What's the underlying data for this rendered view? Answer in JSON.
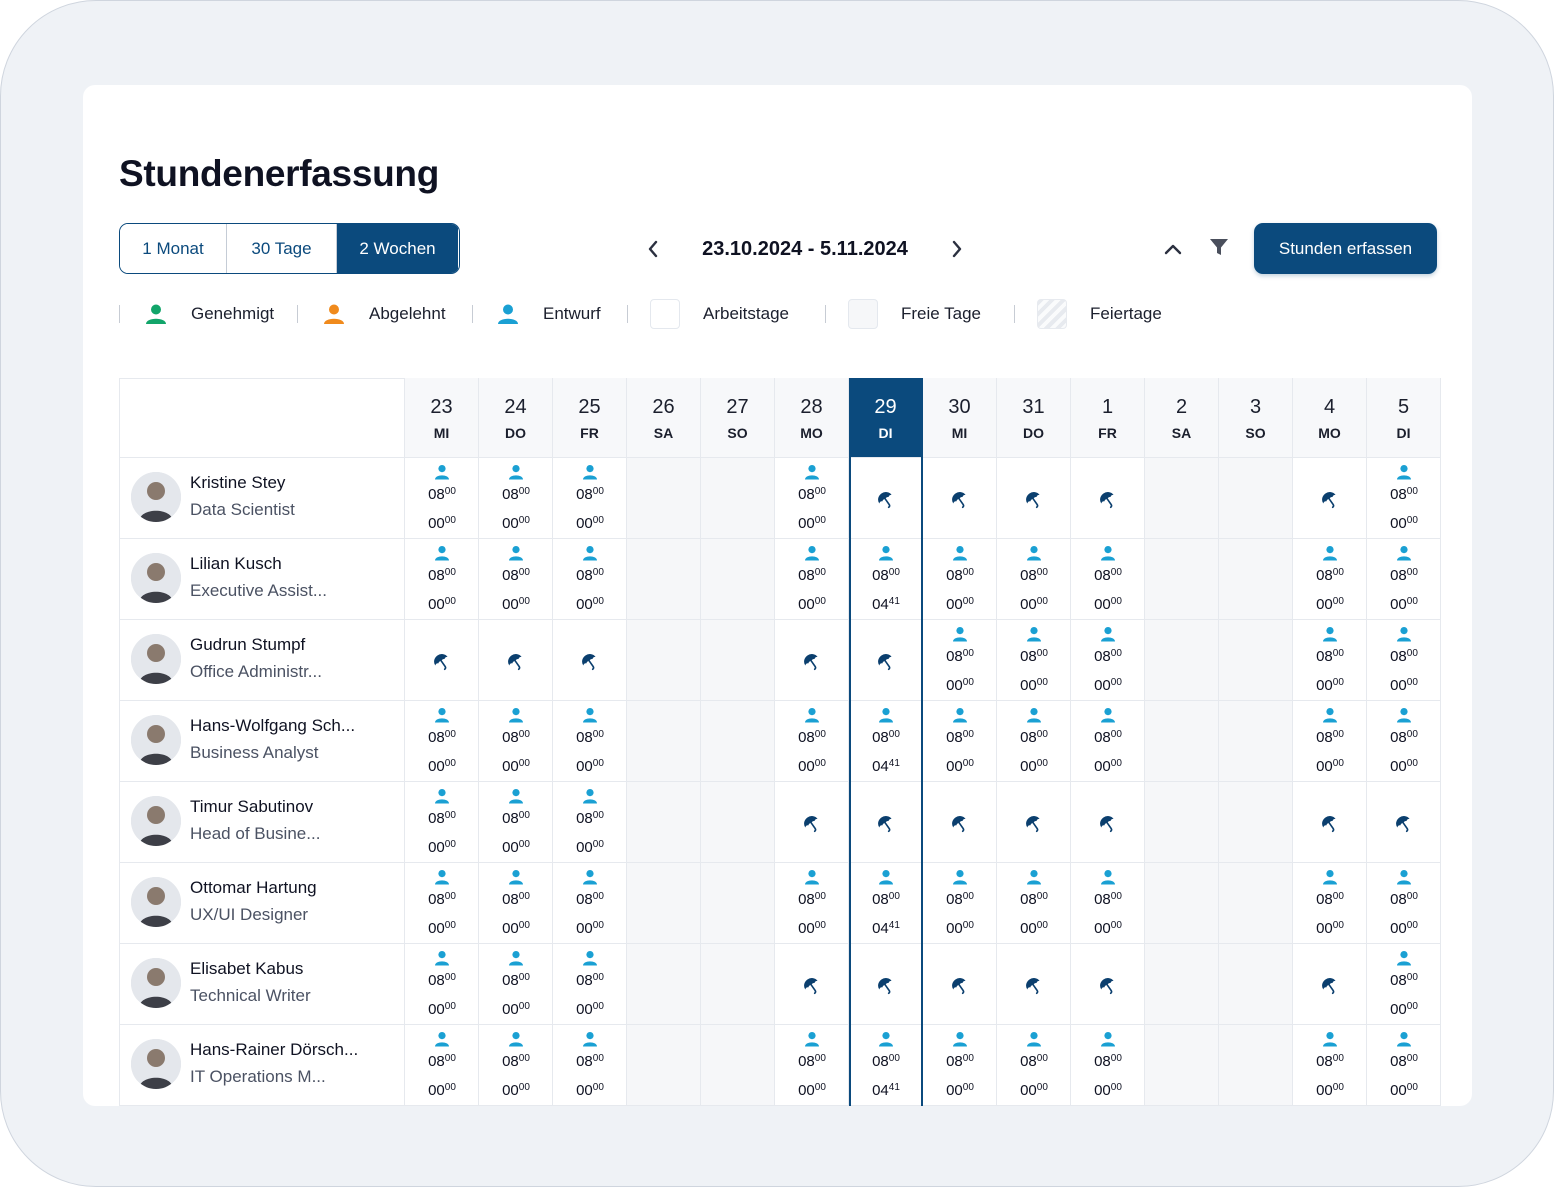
{
  "title": "Stundenerfassung",
  "view_tabs": [
    {
      "label": "1 Monat"
    },
    {
      "label": "30 Tage"
    },
    {
      "label": "2 Wochen"
    }
  ],
  "active_tab": "2 Wochen",
  "date_range": "23.10.2024 - 5.11.2024",
  "primary_button": "Stunden erfassen",
  "legend": [
    {
      "label": "Genehmigt",
      "color": "#12a56a"
    },
    {
      "label": "Abgelehnt",
      "color": "#f08a1c"
    },
    {
      "label": "Entwurf",
      "color": "#1aa0d3"
    },
    {
      "label": "Arbeitstage"
    },
    {
      "label": "Freie Tage"
    },
    {
      "label": "Feiertage"
    }
  ],
  "days": [
    {
      "num": "23",
      "dow": "MI"
    },
    {
      "num": "24",
      "dow": "DO"
    },
    {
      "num": "25",
      "dow": "FR"
    },
    {
      "num": "26",
      "dow": "SA"
    },
    {
      "num": "27",
      "dow": "SO"
    },
    {
      "num": "28",
      "dow": "MO"
    },
    {
      "num": "29",
      "dow": "DI"
    },
    {
      "num": "30",
      "dow": "MI"
    },
    {
      "num": "31",
      "dow": "DO"
    },
    {
      "num": "1",
      "dow": "FR"
    },
    {
      "num": "2",
      "dow": "SA"
    },
    {
      "num": "3",
      "dow": "SO"
    },
    {
      "num": "4",
      "dow": "MO"
    },
    {
      "num": "5",
      "dow": "DI"
    }
  ],
  "today": "29",
  "weekend_columns": [
    3,
    4,
    10,
    11
  ],
  "colors": {
    "accent": "#0b4a7d",
    "draft": "#1aa0d3",
    "vacation": "#0b3f6e"
  },
  "employees": [
    {
      "name": "Kristine Stey",
      "role": "Data Scientist",
      "cells": [
        "e",
        "e",
        "e",
        "",
        "",
        "e",
        "v",
        "v",
        "v",
        "v",
        "",
        "",
        "v",
        "e"
      ]
    },
    {
      "name": "Lilian Kusch",
      "role": "Executive Assist...",
      "cells": [
        "e",
        "e",
        "e",
        "",
        "",
        "e",
        "p",
        "e",
        "e",
        "e",
        "",
        "",
        "e",
        "e"
      ]
    },
    {
      "name": "Gudrun Stumpf",
      "role": "Office Administr...",
      "cells": [
        "v",
        "v",
        "v",
        "",
        "",
        "v",
        "v",
        "e",
        "e",
        "e",
        "",
        "",
        "e",
        "e"
      ]
    },
    {
      "name": "Hans-Wolfgang Sch...",
      "role": "Business Analyst",
      "cells": [
        "e",
        "e",
        "e",
        "",
        "",
        "e",
        "p",
        "e",
        "e",
        "e",
        "",
        "",
        "e",
        "e"
      ]
    },
    {
      "name": "Timur Sabutinov",
      "role": "Head of Busine...",
      "cells": [
        "e",
        "e",
        "e",
        "",
        "",
        "v",
        "v",
        "v",
        "v",
        "v",
        "",
        "",
        "v",
        "v"
      ]
    },
    {
      "name": "Ottomar Hartung",
      "role": "UX/UI Designer",
      "cells": [
        "e",
        "e",
        "e",
        "",
        "",
        "e",
        "p",
        "e",
        "e",
        "e",
        "",
        "",
        "e",
        "e"
      ]
    },
    {
      "name": "Elisabet Kabus",
      "role": "Technical Writer",
      "cells": [
        "e",
        "e",
        "e",
        "",
        "",
        "v",
        "v",
        "v",
        "v",
        "v",
        "",
        "",
        "v",
        "e"
      ]
    },
    {
      "name": "Hans-Rainer Dörsch...",
      "role": "IT Operations M...",
      "cells": [
        "e",
        "e",
        "e",
        "",
        "",
        "e",
        "p",
        "e",
        "e",
        "e",
        "",
        "",
        "e",
        "e"
      ]
    }
  ],
  "cell_entry_full": {
    "h1": "08",
    "m1": "00",
    "h2": "00",
    "m2": "00"
  },
  "cell_entry_partial": {
    "h1": "08",
    "m1": "00",
    "h2": "04",
    "m2": "41"
  }
}
